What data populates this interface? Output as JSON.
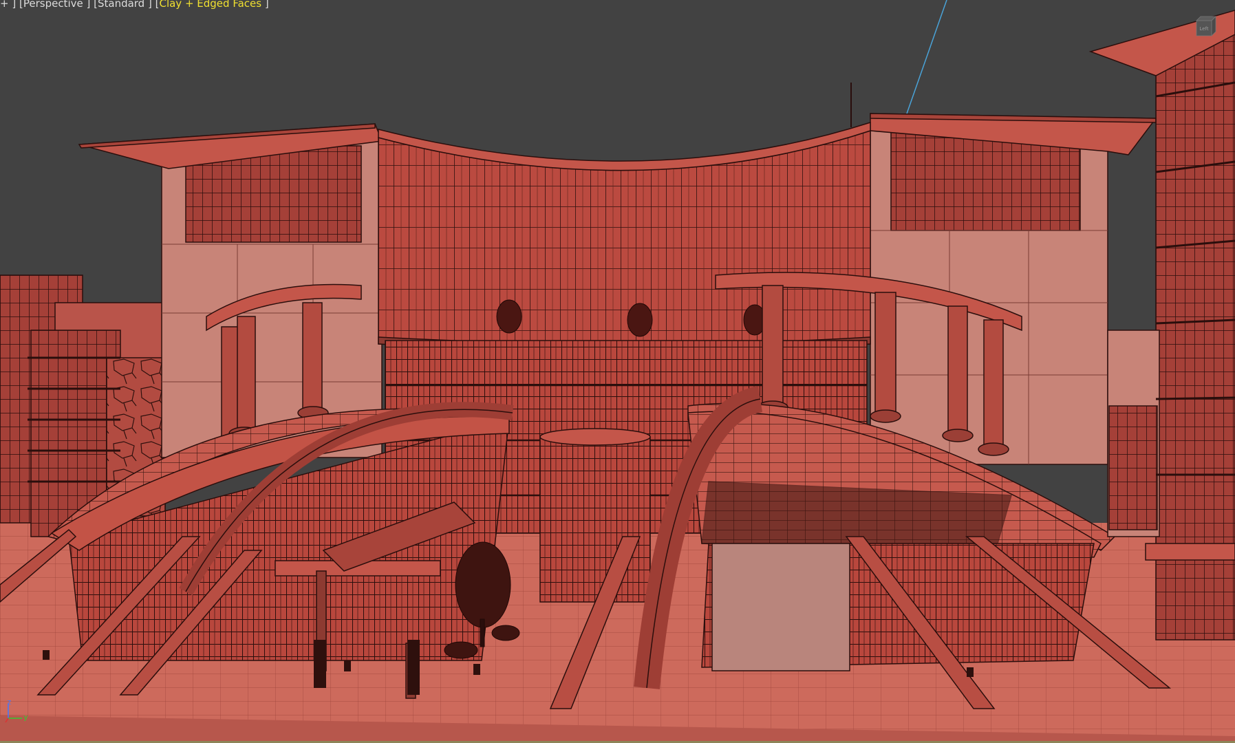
{
  "viewport": {
    "label": {
      "menu": "+",
      "view": "Perspective",
      "render_mode": "Standard",
      "shading": "Clay + Edged Faces"
    },
    "viewcube_label": "Left",
    "axis": {
      "x": "x",
      "y": "y",
      "z": "z"
    }
  },
  "colors": {
    "background": "#424242",
    "clay": "#c4564a",
    "edge": "#3a1612",
    "shading_label": "#f0e030",
    "axis_x": "#d33",
    "axis_y": "#3c3",
    "axis_z": "#47f"
  }
}
